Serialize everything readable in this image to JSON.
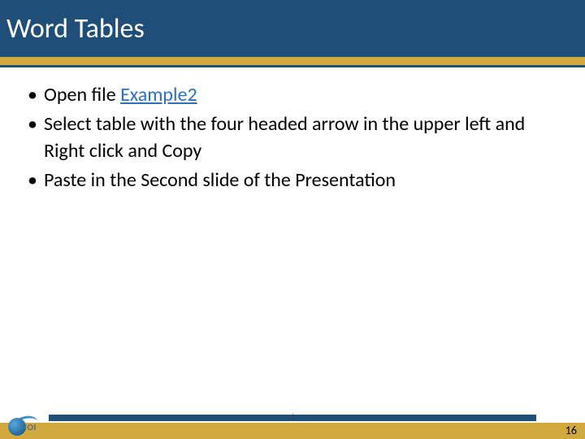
{
  "title": "Word Tables",
  "bullets": [
    {
      "prefix": "Open file ",
      "link": "Example2",
      "suffix": ""
    },
    {
      "text": "Select table with the four headed arrow in the upper left and Right click  and Copy"
    },
    {
      "text": "Paste in the Second slide of the Presentation"
    }
  ],
  "page_number": "16",
  "logo_text": "IOI"
}
